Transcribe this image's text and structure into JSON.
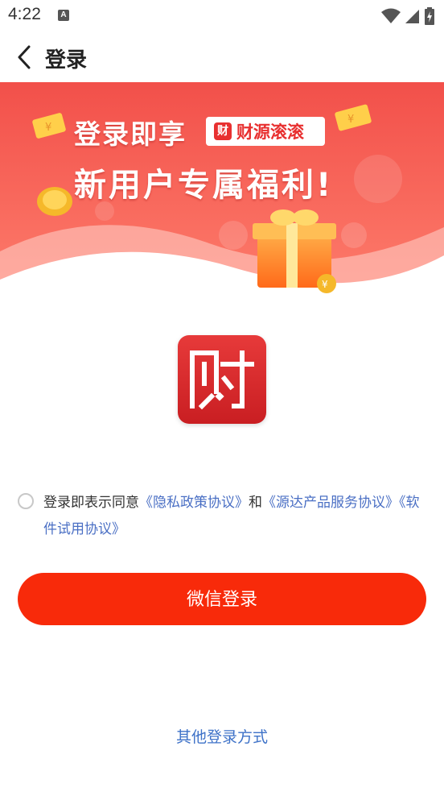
{
  "status_bar": {
    "time": "4:22",
    "notification_icon_letter": "A",
    "icons": [
      "wifi-icon",
      "signal-icon",
      "battery-icon"
    ]
  },
  "header": {
    "title": "登录",
    "back_icon": "chevron-left-icon"
  },
  "banner": {
    "line1": "登录即享",
    "brand_name": "财源滚滚",
    "brand_logo_char": "财",
    "line2": "新用户专属福利!",
    "colors": {
      "top": "#f2564c",
      "bottom": "#ff7b6e",
      "wave": "#ffe3df"
    }
  },
  "app_logo": {
    "icon": "app-logo-icon",
    "color": "#d9262a"
  },
  "agreement": {
    "prefix": "登录即表示同意",
    "privacy_link": "《隐私政策协议》",
    "conjunction": "和",
    "service_link": "《源达产品服务协议》",
    "trial_link": "《软件试用协议》"
  },
  "wechat_login": {
    "label": "微信登录",
    "color": "#f82a0a"
  },
  "other_login": {
    "label": "其他登录方式"
  }
}
